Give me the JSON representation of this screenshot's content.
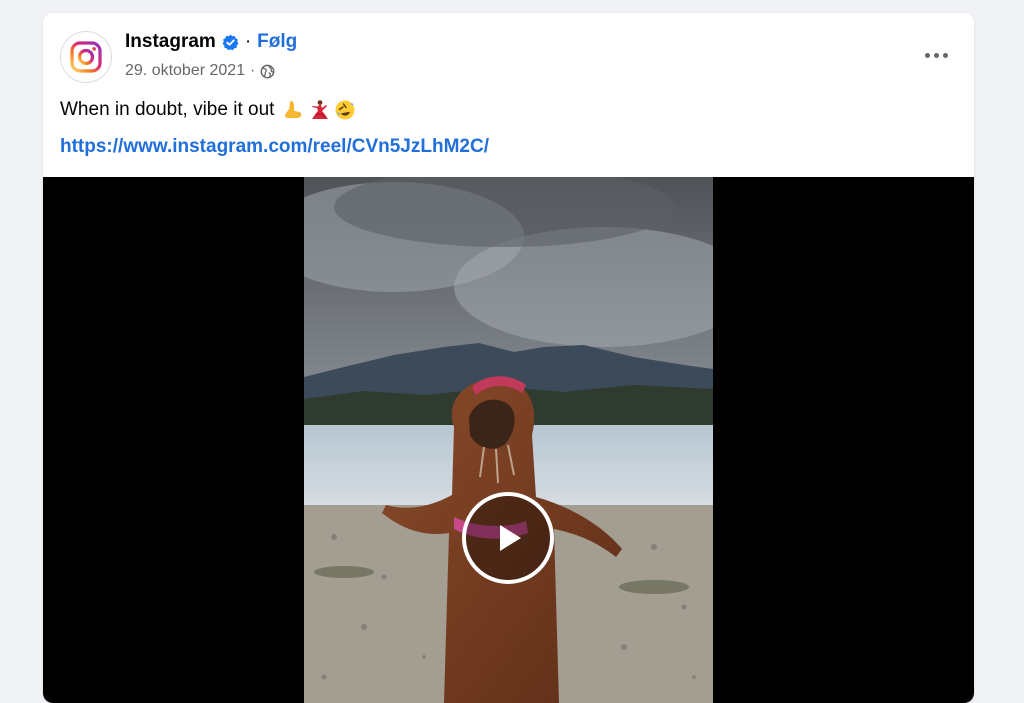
{
  "post": {
    "author": "Instagram",
    "follow_label": "Følg",
    "separator": "·",
    "date": "29. oktober 2021",
    "caption": "When in doubt, vibe it out",
    "emoji_icons": [
      "foot-icon",
      "dancer-icon",
      "rolling-laugh-icon"
    ],
    "link": "https://www.instagram.com/reel/CVn5JzLhM2C/",
    "verified_icon": "verified-badge-icon",
    "privacy_icon": "globe-icon",
    "menu_icon": "more-options-icon"
  },
  "video": {
    "play_icon": "play-icon",
    "description": ""
  },
  "colors": {
    "link": "#216fdb",
    "secondary_text": "#65676b",
    "background": "#f0f2f5",
    "verified": "#1877f2"
  }
}
